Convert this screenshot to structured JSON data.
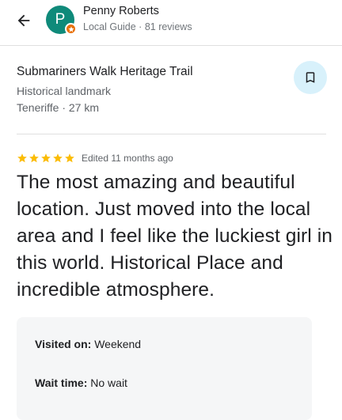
{
  "colors": {
    "avatar_bg": "#0f8a7a",
    "badge_bg": "#e8710a",
    "save_bg": "#d8f1fb",
    "star": "#fbbc04",
    "details_bg": "#f5f6f7"
  },
  "header": {
    "back_icon": "arrow-back-icon",
    "avatar_initial": "P",
    "user_name": "Penny Roberts",
    "user_meta": "Local Guide · 81 reviews"
  },
  "place": {
    "name": "Submariners Walk Heritage Trail",
    "category": "Historical landmark",
    "location": "Teneriffe · 27 km",
    "save_icon": "bookmark-icon"
  },
  "review": {
    "rating": 5,
    "rating_max": 5,
    "edited": "Edited 11 months ago",
    "text": "The most amazing and beautiful location. Just moved into the local area and I feel like the luckiest girl in this world. Historical Place and incredible atmosphere."
  },
  "details": {
    "visited_label": "Visited on:",
    "visited_value": "Weekend",
    "wait_label": "Wait time:",
    "wait_value": "No wait"
  }
}
